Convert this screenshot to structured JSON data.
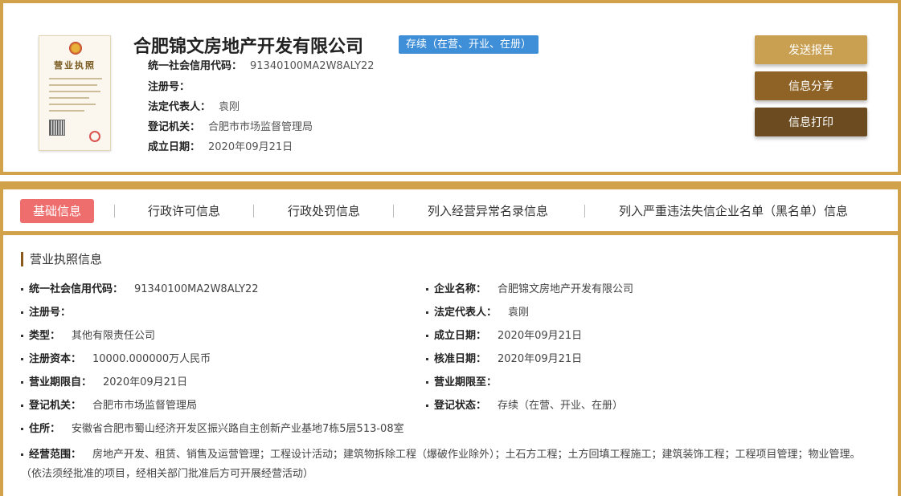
{
  "header": {
    "license_image": {
      "title": "营业执照"
    },
    "company_name": "合肥锦文房地产开发有限公司",
    "status_badge": "存续（在营、开业、在册）",
    "rows": [
      {
        "label": "统一社会信用代码：",
        "value": "91340100MA2W8ALY22"
      },
      {
        "label": "注册号：",
        "value": ""
      },
      {
        "label": "法定代表人：",
        "value": "袁刚"
      },
      {
        "label": "登记机关：",
        "value": "合肥市市场监督管理局"
      },
      {
        "label": "成立日期：",
        "value": "2020年09月21日"
      }
    ],
    "buttons": {
      "send": "发送报告",
      "share": "信息分享",
      "print": "信息打印"
    }
  },
  "tabs": [
    {
      "label": "基础信息",
      "active": true
    },
    {
      "label": "行政许可信息",
      "active": false
    },
    {
      "label": "行政处罚信息",
      "active": false
    },
    {
      "label": "列入经营异常名录信息",
      "active": false
    },
    {
      "label": "列入严重违法失信企业名单（黑名单）信息",
      "active": false
    }
  ],
  "details": {
    "section_title": "营业执照信息",
    "left": [
      {
        "label": "统一社会信用代码：",
        "value": "91340100MA2W8ALY22"
      },
      {
        "label": "注册号：",
        "value": ""
      },
      {
        "label": "类型：",
        "value": "其他有限责任公司"
      },
      {
        "label": "注册资本：",
        "value": "10000.000000万人民币"
      },
      {
        "label": "营业期限自：",
        "value": "2020年09月21日"
      },
      {
        "label": "登记机关：",
        "value": "合肥市市场监督管理局"
      }
    ],
    "right": [
      {
        "label": "企业名称：",
        "value": "合肥锦文房地产开发有限公司"
      },
      {
        "label": "法定代表人：",
        "value": "袁刚"
      },
      {
        "label": "成立日期：",
        "value": "2020年09月21日"
      },
      {
        "label": "核准日期：",
        "value": "2020年09月21日"
      },
      {
        "label": "营业期限至：",
        "value": ""
      },
      {
        "label": "登记状态：",
        "value": "存续（在营、开业、在册）"
      }
    ],
    "address": {
      "label": "住所：",
      "value": "安徽省合肥市蜀山经济开发区振兴路自主创新产业基地7栋5层513-08室"
    },
    "scope": {
      "label": "经营范围：",
      "value": "房地产开发、租赁、销售及运营管理；工程设计活动；建筑物拆除工程（爆破作业除外）；土石方工程；土方回填工程施工；建筑装饰工程；工程项目管理；物业管理。（依法须经批准的项目，经相关部门批准后方可开展经营活动）"
    }
  },
  "colors": {
    "gold_border": "#d1a24a",
    "status_blue": "#3f8fd8",
    "active_tab": "#ee6e6e",
    "btn_send": "#c99f52",
    "btn_share": "#8f6326",
    "btn_print": "#6b4b1f"
  }
}
